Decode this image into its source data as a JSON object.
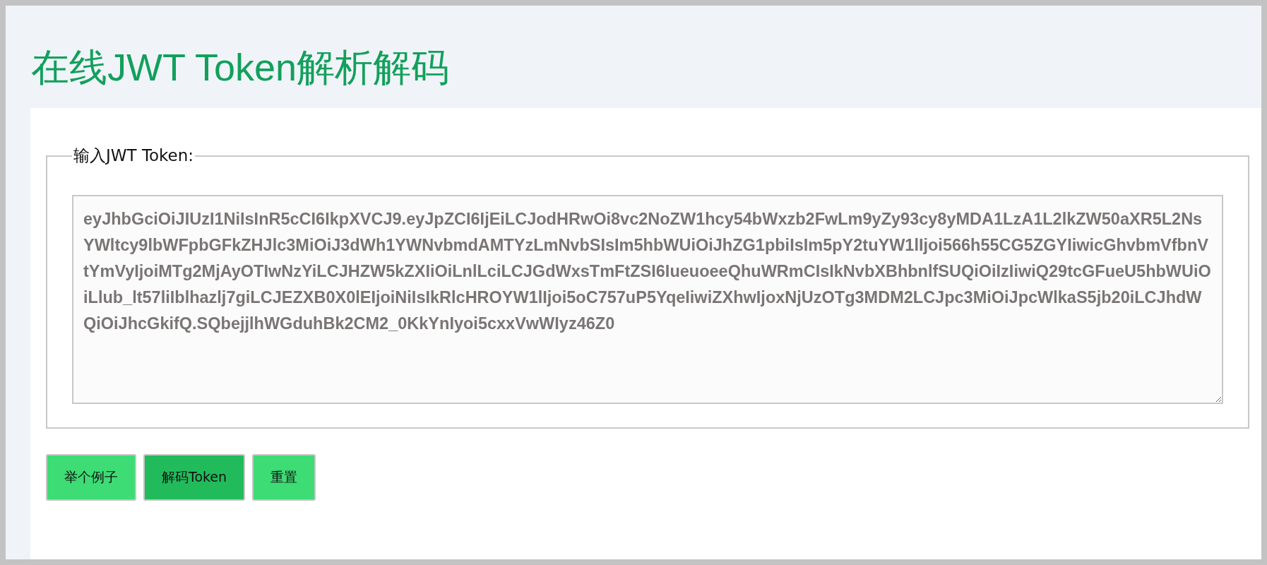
{
  "title": "在线JWT Token解析解码",
  "token_field": {
    "legend": "输入JWT Token:",
    "value": "eyJhbGciOiJIUzI1NiIsInR5cCI6IkpXVCJ9.eyJpZCI6IjEiLCJodHRwOi8vc2NoZW1hcy54bWxzb2FwLm9yZy93cy8yMDA1LzA1L2lkZW50aXR5L2NsYWltcy9lbWFpbGFkZHJlc3MiOiJ3dWh1YWNvbmdAMTYzLmNvbSIsIm5hbWUiOiJhZG1pbiIsIm5pY2tuYW1lIjoi566h55CG5ZGYIiwicGhvbmVfbnVtYmVyIjoiMTg2MjAyOTIwNzYiLCJHZW5kZXIiOiLnlLciLCJGdWxsTmFtZSI6IueuoeeQhuWRmCIsIkNvbXBhbnlfSUQiOiIzIiwiQ29tcGFueU5hbWUiOiLlub_lt57liIblhazlj7giLCJEZXB0X0lEIjoiNiIsIkRlcHROYW1lIjoi5oC757uP5YqeIiwiZXhwIjoxNjUzOTg3MDM2LCJpc3MiOiJpcWlkaS5jb20iLCJhdWQiOiJhcGkifQ.SQbejjlhWGduhBk2CM2_0KkYnIyoi5cxxVwWIyz46Z0"
  },
  "buttons": [
    {
      "label": "举个例子",
      "kind": "normal"
    },
    {
      "label": "解码Token",
      "kind": "active"
    },
    {
      "label": "重置",
      "kind": "normal"
    }
  ]
}
